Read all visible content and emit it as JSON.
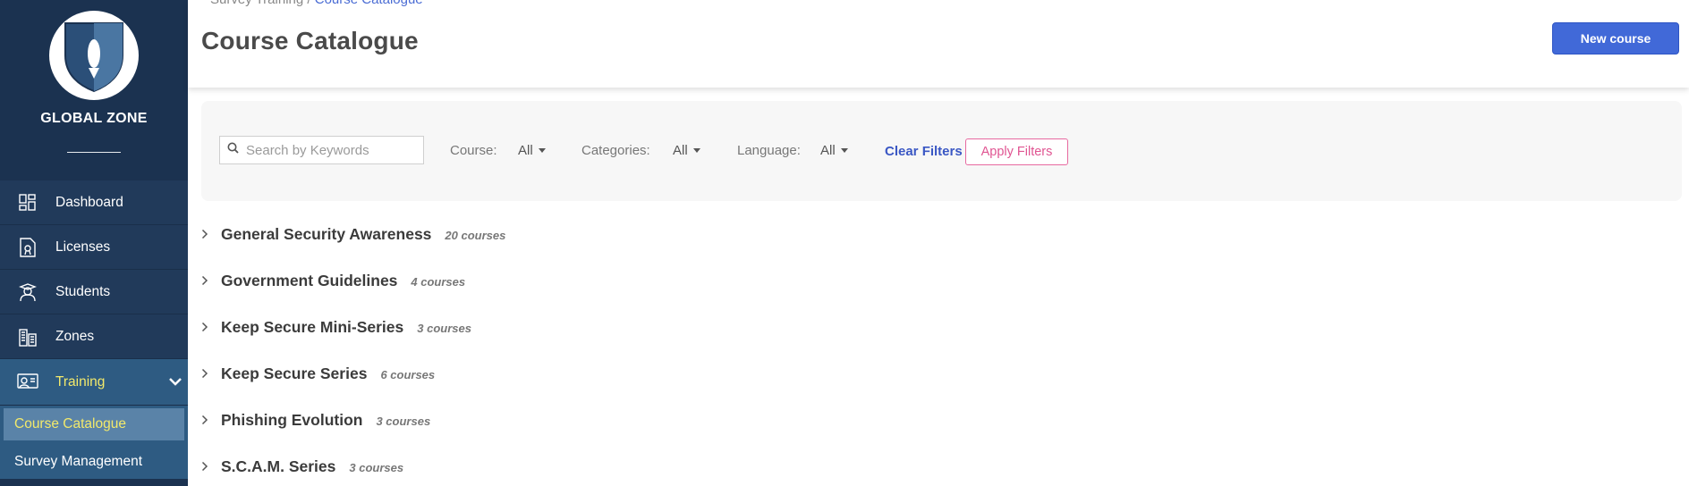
{
  "brand": {
    "name": "GLOBAL ZONE"
  },
  "breadcrumb": {
    "parent": "Survey Training",
    "separator": "/",
    "current": "Course Catalogue"
  },
  "header": {
    "title": "Course Catalogue",
    "new_course_label": "New course"
  },
  "sidebar": {
    "items": [
      {
        "label": "Dashboard",
        "icon": "dashboard-icon"
      },
      {
        "label": "Licenses",
        "icon": "licenses-icon"
      },
      {
        "label": "Students",
        "icon": "students-icon"
      },
      {
        "label": "Zones",
        "icon": "zones-icon"
      },
      {
        "label": "Training",
        "icon": "training-icon",
        "expanded": true
      }
    ],
    "sub_items": [
      {
        "label": "Course Catalogue",
        "active": true
      },
      {
        "label": "Survey Management",
        "active": false
      }
    ]
  },
  "filters": {
    "search_placeholder": "Search by Keywords",
    "course_label": "Course:",
    "course_value": "All",
    "categories_label": "Categories:",
    "categories_value": "All",
    "language_label": "Language:",
    "language_value": "All",
    "clear_label": "Clear Filters",
    "apply_label": "Apply Filters"
  },
  "categories": [
    {
      "name": "General Security Awareness",
      "count": "20 courses"
    },
    {
      "name": "Government Guidelines",
      "count": "4 courses"
    },
    {
      "name": "Keep Secure Mini-Series",
      "count": "3 courses"
    },
    {
      "name": "Keep Secure Series",
      "count": "6 courses"
    },
    {
      "name": "Phishing Evolution",
      "count": "3 courses"
    },
    {
      "name": "S.C.A.M. Series",
      "count": "3 courses"
    }
  ],
  "colors": {
    "sidebar_bg": "#1b3250",
    "sidebar_active": "#2e5b82",
    "active_text": "#f2e96b",
    "primary_button": "#4169d8",
    "apply_outline": "#e76aa0"
  }
}
